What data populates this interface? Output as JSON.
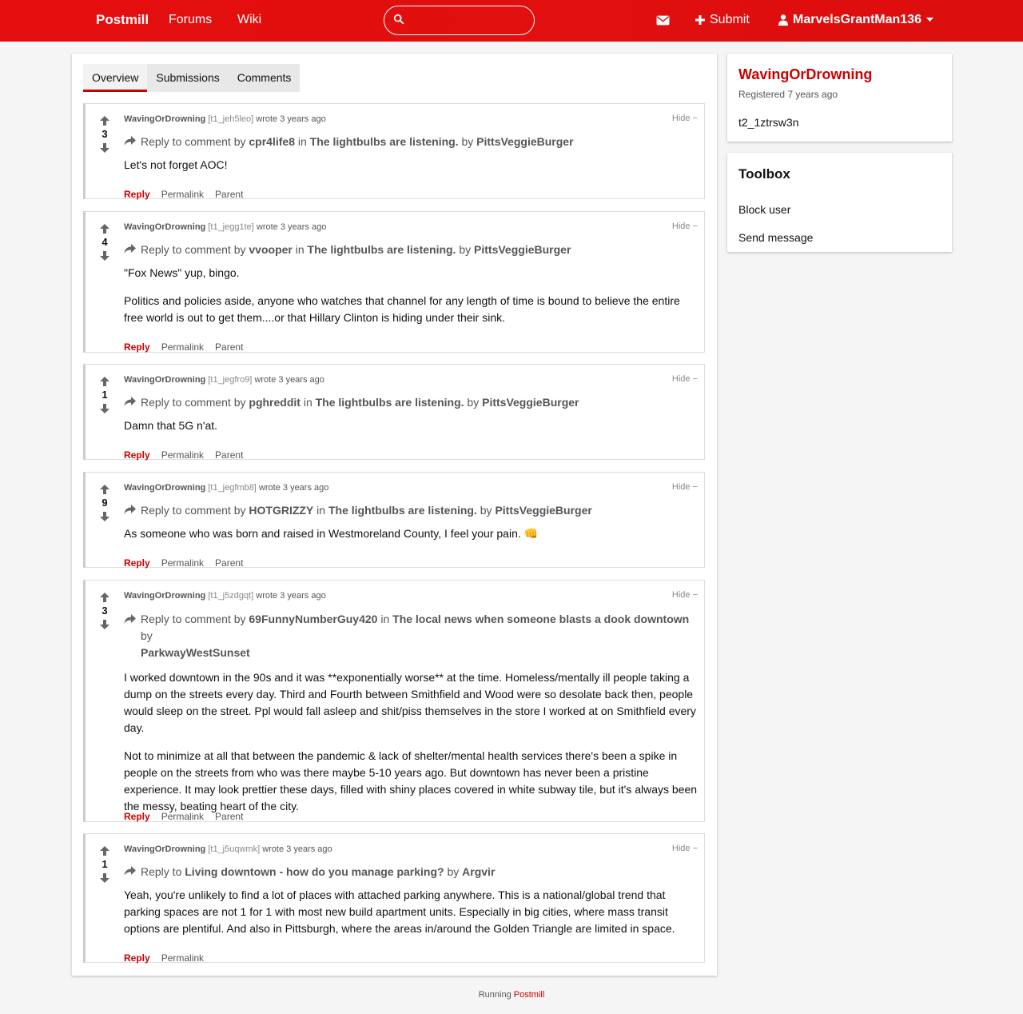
{
  "header": {
    "brand": "Postmill",
    "nav": [
      "Forums",
      "Wiki"
    ],
    "search_placeholder": "",
    "submit_label": "Submit",
    "username": "MarvelsGrantMan136",
    "accent_color": "#e10f0f"
  },
  "tabs": [
    "Overview",
    "Submissions",
    "Comments"
  ],
  "comments": [
    {
      "author": "WavingOrDrowning",
      "id": "[t1_jeh5leo]",
      "time": "wrote 3 years ago",
      "score": "3",
      "hide": "Hide −",
      "reply_prefix": "Reply to comment by",
      "target_user": "cpr4life8",
      "in": "in",
      "post_title": "The lightbulbs are listening.",
      "by": "by",
      "post_author": "PittsVeggieBurger",
      "paragraphs": [
        "Let's not forget AOC!"
      ],
      "actions": [
        "Reply",
        "Permalink",
        "Parent"
      ]
    },
    {
      "author": "WavingOrDrowning",
      "id": "[t1_jegg1te]",
      "time": "wrote 3 years ago",
      "score": "4",
      "hide": "Hide −",
      "reply_prefix": "Reply to comment by",
      "target_user": "vvooper",
      "in": "in",
      "post_title": "The lightbulbs are listening.",
      "by": "by",
      "post_author": "PittsVeggieBurger",
      "paragraphs": [
        "\"Fox News\" yup, bingo.",
        "Politics and policies aside, anyone who watches that channel for any length of time is bound to believe the entire free world is out to get them....or that Hillary Clinton is hiding under their sink."
      ],
      "actions": [
        "Reply",
        "Permalink",
        "Parent"
      ]
    },
    {
      "author": "WavingOrDrowning",
      "id": "[t1_jegfro9]",
      "time": "wrote 3 years ago",
      "score": "1",
      "hide": "Hide −",
      "reply_prefix": "Reply to comment by",
      "target_user": "pghreddit",
      "in": "in",
      "post_title": "The lightbulbs are listening.",
      "by": "by",
      "post_author": "PittsVeggieBurger",
      "paragraphs": [
        "Damn that 5G n'at."
      ],
      "actions": [
        "Reply",
        "Permalink",
        "Parent"
      ]
    },
    {
      "author": "WavingOrDrowning",
      "id": "[t1_jegfmb8]",
      "time": "wrote 3 years ago",
      "score": "9",
      "hide": "Hide −",
      "reply_prefix": "Reply to comment by",
      "target_user": "HOTGRIZZY",
      "in": "in",
      "post_title": "The lightbulbs are listening.",
      "by": "by",
      "post_author": "PittsVeggieBurger",
      "paragraphs": [
        "As someone who was born and raised in Westmoreland County, I feel your pain. 👊"
      ],
      "actions": [
        "Reply",
        "Permalink",
        "Parent"
      ]
    },
    {
      "author": "WavingOrDrowning",
      "id": "[t1_j5zdgqt]",
      "time": "wrote 3 years ago",
      "score": "3",
      "hide": "Hide −",
      "reply_prefix": "Reply to comment by",
      "target_user": "69FunnyNumberGuy420",
      "in": "in",
      "post_title": "The local news when someone blasts a dook downtown",
      "by": "by",
      "post_author": "ParkwayWestSunset",
      "paragraphs": [
        "I worked downtown in the 90s and it was **exponentially worse** at the time. Homeless/mentally ill people taking a dump on the streets every day. Third and Fourth between Smithfield and Wood were so desolate back then, people would sleep on the street. Ppl would fall asleep and shit/piss themselves in the store I worked at on Smithfield every day.",
        "Not to minimize at all that between the pandemic & lack of shelter/mental health services there's been a spike in people on the streets from who was there maybe 5-10 years ago. But downtown has never been a pristine experience. It may look prettier these days, filled with shiny places covered in white subway tile, but it's always been the messy, beating heart of the city."
      ],
      "actions": [
        "Reply",
        "Permalink",
        "Parent"
      ]
    },
    {
      "author": "WavingOrDrowning",
      "id": "[t1_j5uqwmk]",
      "time": "wrote 3 years ago",
      "score": "1",
      "hide": "Hide −",
      "reply_prefix": "Reply to",
      "target_user": "",
      "in": "",
      "post_title": "Living downtown - how do you manage parking?",
      "by": "by",
      "post_author": "Argvir",
      "paragraphs": [
        "Yeah, you're unlikely to find a lot of places with attached parking anywhere. This is a national/global trend that parking spaces are not 1 for 1 with most new build apartment units. Especially in big cities, where mass transit options are plentiful. And also in Pittsburgh, where the areas in/around the Golden Triangle are limited in space."
      ],
      "actions": [
        "Reply",
        "Permalink"
      ]
    }
  ],
  "sidebar": {
    "username": "WavingOrDrowning",
    "registered": "Registered 7 years ago",
    "user_id": "t2_1ztrsw3n",
    "toolbox_title": "Toolbox",
    "toolbox_items": [
      "Block user",
      "Send message"
    ]
  },
  "footer": {
    "prefix": "Running",
    "link": "Postmill"
  }
}
